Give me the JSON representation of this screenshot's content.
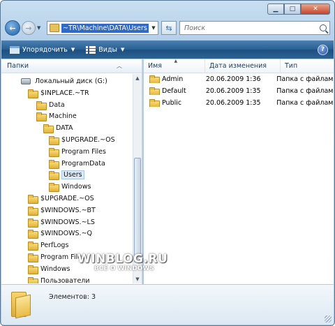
{
  "address": {
    "path": "~TR\\Machine\\DATA\\Users"
  },
  "search": {
    "placeholder": "Поиск"
  },
  "toolbar": {
    "organize_label": "Упорядочить",
    "views_label": "Виды",
    "help_label": "?"
  },
  "navpane": {
    "header": "Папки",
    "items": [
      {
        "label": "Локальный диск (G:)",
        "icon": "drive-icon",
        "selected": false
      },
      {
        "label": "$INPLACE.~TR",
        "icon": "folder-icon",
        "selected": false
      },
      {
        "label": "Data",
        "icon": "folder-icon",
        "selected": false
      },
      {
        "label": "Machine",
        "icon": "folder-icon",
        "selected": false
      },
      {
        "label": "DATA",
        "icon": "folder-icon",
        "selected": false
      },
      {
        "label": "$UPGRADE.~OS",
        "icon": "folder-icon",
        "selected": false
      },
      {
        "label": "Program Files",
        "icon": "folder-icon",
        "selected": false
      },
      {
        "label": "ProgramData",
        "icon": "folder-icon",
        "selected": false
      },
      {
        "label": "Users",
        "icon": "folder-icon",
        "selected": true
      },
      {
        "label": "Windows",
        "icon": "folder-icon",
        "selected": false
      },
      {
        "label": "$UPGRADE.~OS",
        "icon": "folder-icon",
        "selected": false
      },
      {
        "label": "$WINDOWS.~BT",
        "icon": "folder-icon",
        "selected": false
      },
      {
        "label": "$WINDOWS.~LS",
        "icon": "folder-icon",
        "selected": false
      },
      {
        "label": "$WINDOWS.~Q",
        "icon": "folder-icon",
        "selected": false
      },
      {
        "label": "PerfLogs",
        "icon": "folder-icon",
        "selected": false
      },
      {
        "label": "Program Files",
        "icon": "folder-icon",
        "selected": false
      },
      {
        "label": "Windows",
        "icon": "folder-icon",
        "selected": false
      },
      {
        "label": "Пользователи",
        "icon": "folder-icon",
        "selected": false
      }
    ]
  },
  "filelist": {
    "columns": {
      "name": "Имя",
      "date": "Дата изменения",
      "type": "Тип"
    },
    "rows": [
      {
        "name": "Admin",
        "date": "20.06.2009 1:36",
        "type": "Папка с файлами"
      },
      {
        "name": "Default",
        "date": "20.06.2009 1:35",
        "type": "Папка с файлами"
      },
      {
        "name": "Public",
        "date": "20.06.2009 1:35",
        "type": "Папка с файлами"
      }
    ]
  },
  "details": {
    "count": "Элементов: 3"
  },
  "watermark": {
    "main": "WINBLOG.RU",
    "sub": "ВСЁ О WINDOWS"
  }
}
